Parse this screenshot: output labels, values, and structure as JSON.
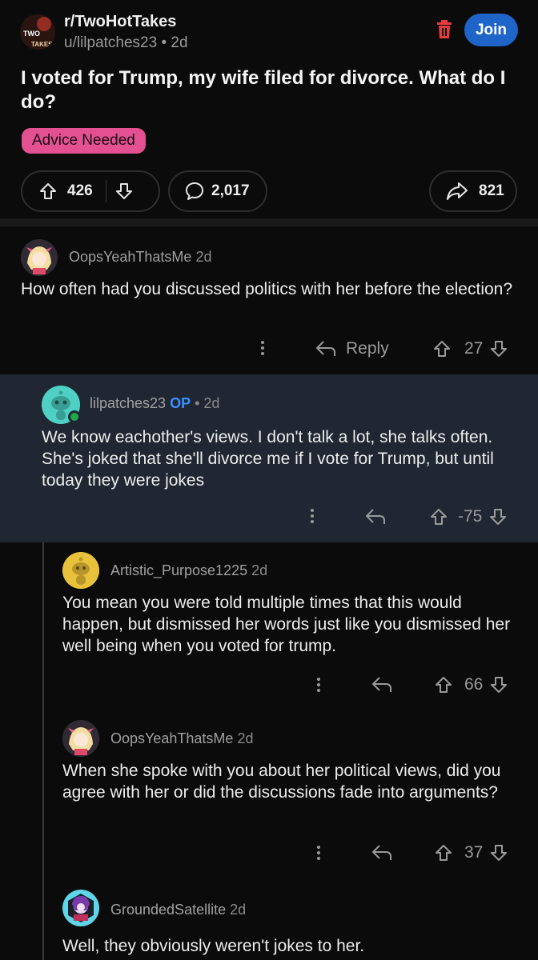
{
  "post": {
    "subreddit": "r/TwoHotTakes",
    "author": "u/lilpatches23",
    "age": "2d",
    "join_label": "Join",
    "title": "I voted for Trump, my wife filed for divorce. What do I do?",
    "flair": "Advice Needed",
    "upvotes": "426",
    "comments": "2,017",
    "shares": "821",
    "colors": {
      "join": "#1f64c9",
      "flair": "#e45192",
      "trash": "#e33c3c",
      "op": "#3b8fff"
    },
    "subreddit_logo_text": "TWO TAKES"
  },
  "comments": [
    {
      "user": "OopsYeahThatsMe",
      "age": "2d",
      "body": "How often had you discussed politics with her before the election?",
      "reply_label": "Reply",
      "score": "27"
    },
    {
      "user": "lilpatches23",
      "op_label": "OP",
      "age": "• 2d",
      "body": "We know eachother's views. I don't talk a lot, she talks often. She's joked that she'll divorce me if I vote for Trump, but until today they were jokes",
      "score": "-75"
    },
    {
      "user": "Artistic_Purpose1225",
      "age": "2d",
      "body": "You mean you were told multiple times that this would happen, but dismissed her words just like you dismissed her well being when you voted for trump.",
      "score": "66"
    },
    {
      "user": "OopsYeahThatsMe",
      "age": "2d",
      "body": "When she spoke with you about her political views, did you agree with her or did the discussions fade into arguments?",
      "score": "37"
    },
    {
      "user": "GroundedSatellite",
      "age": "2d",
      "body": "Well, they obviously weren't jokes to her."
    }
  ]
}
